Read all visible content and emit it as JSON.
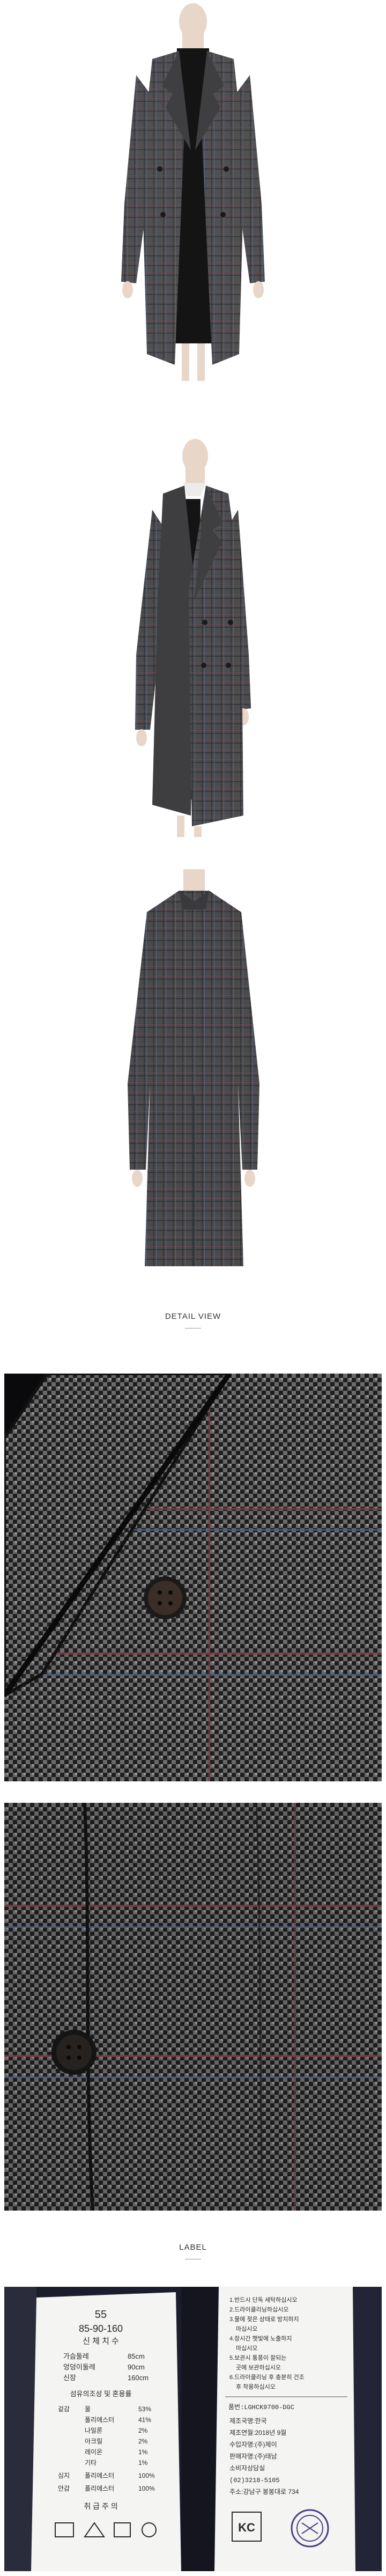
{
  "sections": {
    "detail_view_heading": "DETAIL VIEW",
    "label_heading": "LABEL"
  },
  "care_tag": {
    "size": "55",
    "size_code": "85-90-160",
    "size_caption": "신 체 치 수",
    "measure_rows": [
      {
        "name": "가슴둘레",
        "value": "85cm"
      },
      {
        "name": "엉덩이둘레",
        "value": "90cm"
      },
      {
        "name": "신장",
        "value": "160cm"
      }
    ],
    "fabric_caption": "섬유의조성 및 혼용률",
    "fabric_rows": [
      {
        "part": "겉감",
        "fiber": "울",
        "pct": "53%"
      },
      {
        "part": "",
        "fiber": "폴리에스터",
        "pct": "41%"
      },
      {
        "part": "",
        "fiber": "나일론",
        "pct": "2%"
      },
      {
        "part": "",
        "fiber": "아크릴",
        "pct": "2%"
      },
      {
        "part": "",
        "fiber": "레이온",
        "pct": "1%"
      },
      {
        "part": "",
        "fiber": "기타",
        "pct": "1%"
      },
      {
        "part": "심지",
        "fiber": "폴리에스터",
        "pct": "100%"
      },
      {
        "part": "안감",
        "fiber": "폴리에스터",
        "pct": "100%"
      }
    ],
    "footer": "취 급 주 의"
  },
  "info_tag": {
    "warnings": [
      "1.반드시 단독 세탁하십시오",
      "2.드라이클리닝하십시오",
      "3.물에 젖은 상태로 방치하지",
      "마십시오",
      "4.장시간 햇빛에 노출하지",
      "마십시오",
      "5.보관시 통풍이 잘되는",
      "곳에 보관하십시오",
      "6.드라이클리닝 후 충분히 건조",
      "후 착용하십시오"
    ],
    "product_code": "품번:LGHCK9700-DGC",
    "rows": [
      "제조국명:한국",
      "제조연월:2018년 9월",
      "수입자명:(주)제이",
      "판매자명:(주)태남",
      "소비자상담실",
      "(02)3218-5105",
      "주소:강남구 봉봉대로 734"
    ],
    "cert_mark": "KC"
  },
  "colors": {
    "coat_base": "#4a4a4c",
    "coat_check": "#2c2c2e",
    "coat_red": "#7a3a44",
    "coat_blue": "#4a5f86",
    "dress": "#141414",
    "skin": "#e8d6c8",
    "tag_bg": "#f4f4f2"
  }
}
